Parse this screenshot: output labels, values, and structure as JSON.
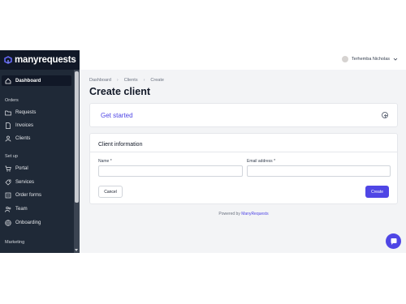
{
  "brand": {
    "name": "manyrequests",
    "accent": "#4f46e5"
  },
  "topbar": {
    "user_name": "Terhemba Nicholas"
  },
  "sidebar": {
    "dashboard": "Dashboard",
    "sections": [
      {
        "label": "Orders",
        "items": [
          "Requests",
          "Invoices",
          "Clients"
        ]
      },
      {
        "label": "Set up",
        "items": [
          "Portal",
          "Services",
          "Order forms",
          "Team",
          "Onboarding"
        ]
      },
      {
        "label": "Marketing",
        "items": []
      }
    ]
  },
  "breadcrumb": [
    "Dashboard",
    "Clients",
    "Create"
  ],
  "page": {
    "title": "Create client"
  },
  "get_started": {
    "label": "Get started"
  },
  "form": {
    "title": "Client information",
    "name_label": "Name *",
    "name_value": "",
    "email_label": "Email address *",
    "email_value": "",
    "cancel_label": "Cancel",
    "create_label": "Create"
  },
  "footer": {
    "prefix": "Powered by",
    "brand": "ManyRequests"
  },
  "icons": [
    "home-icon",
    "folder-icon",
    "document-icon",
    "clients-icon",
    "portal-icon",
    "services-icon",
    "order-forms-icon",
    "team-icon",
    "onboarding-icon",
    "chevron-down-icon",
    "plus-circle-icon",
    "chat-icon"
  ]
}
